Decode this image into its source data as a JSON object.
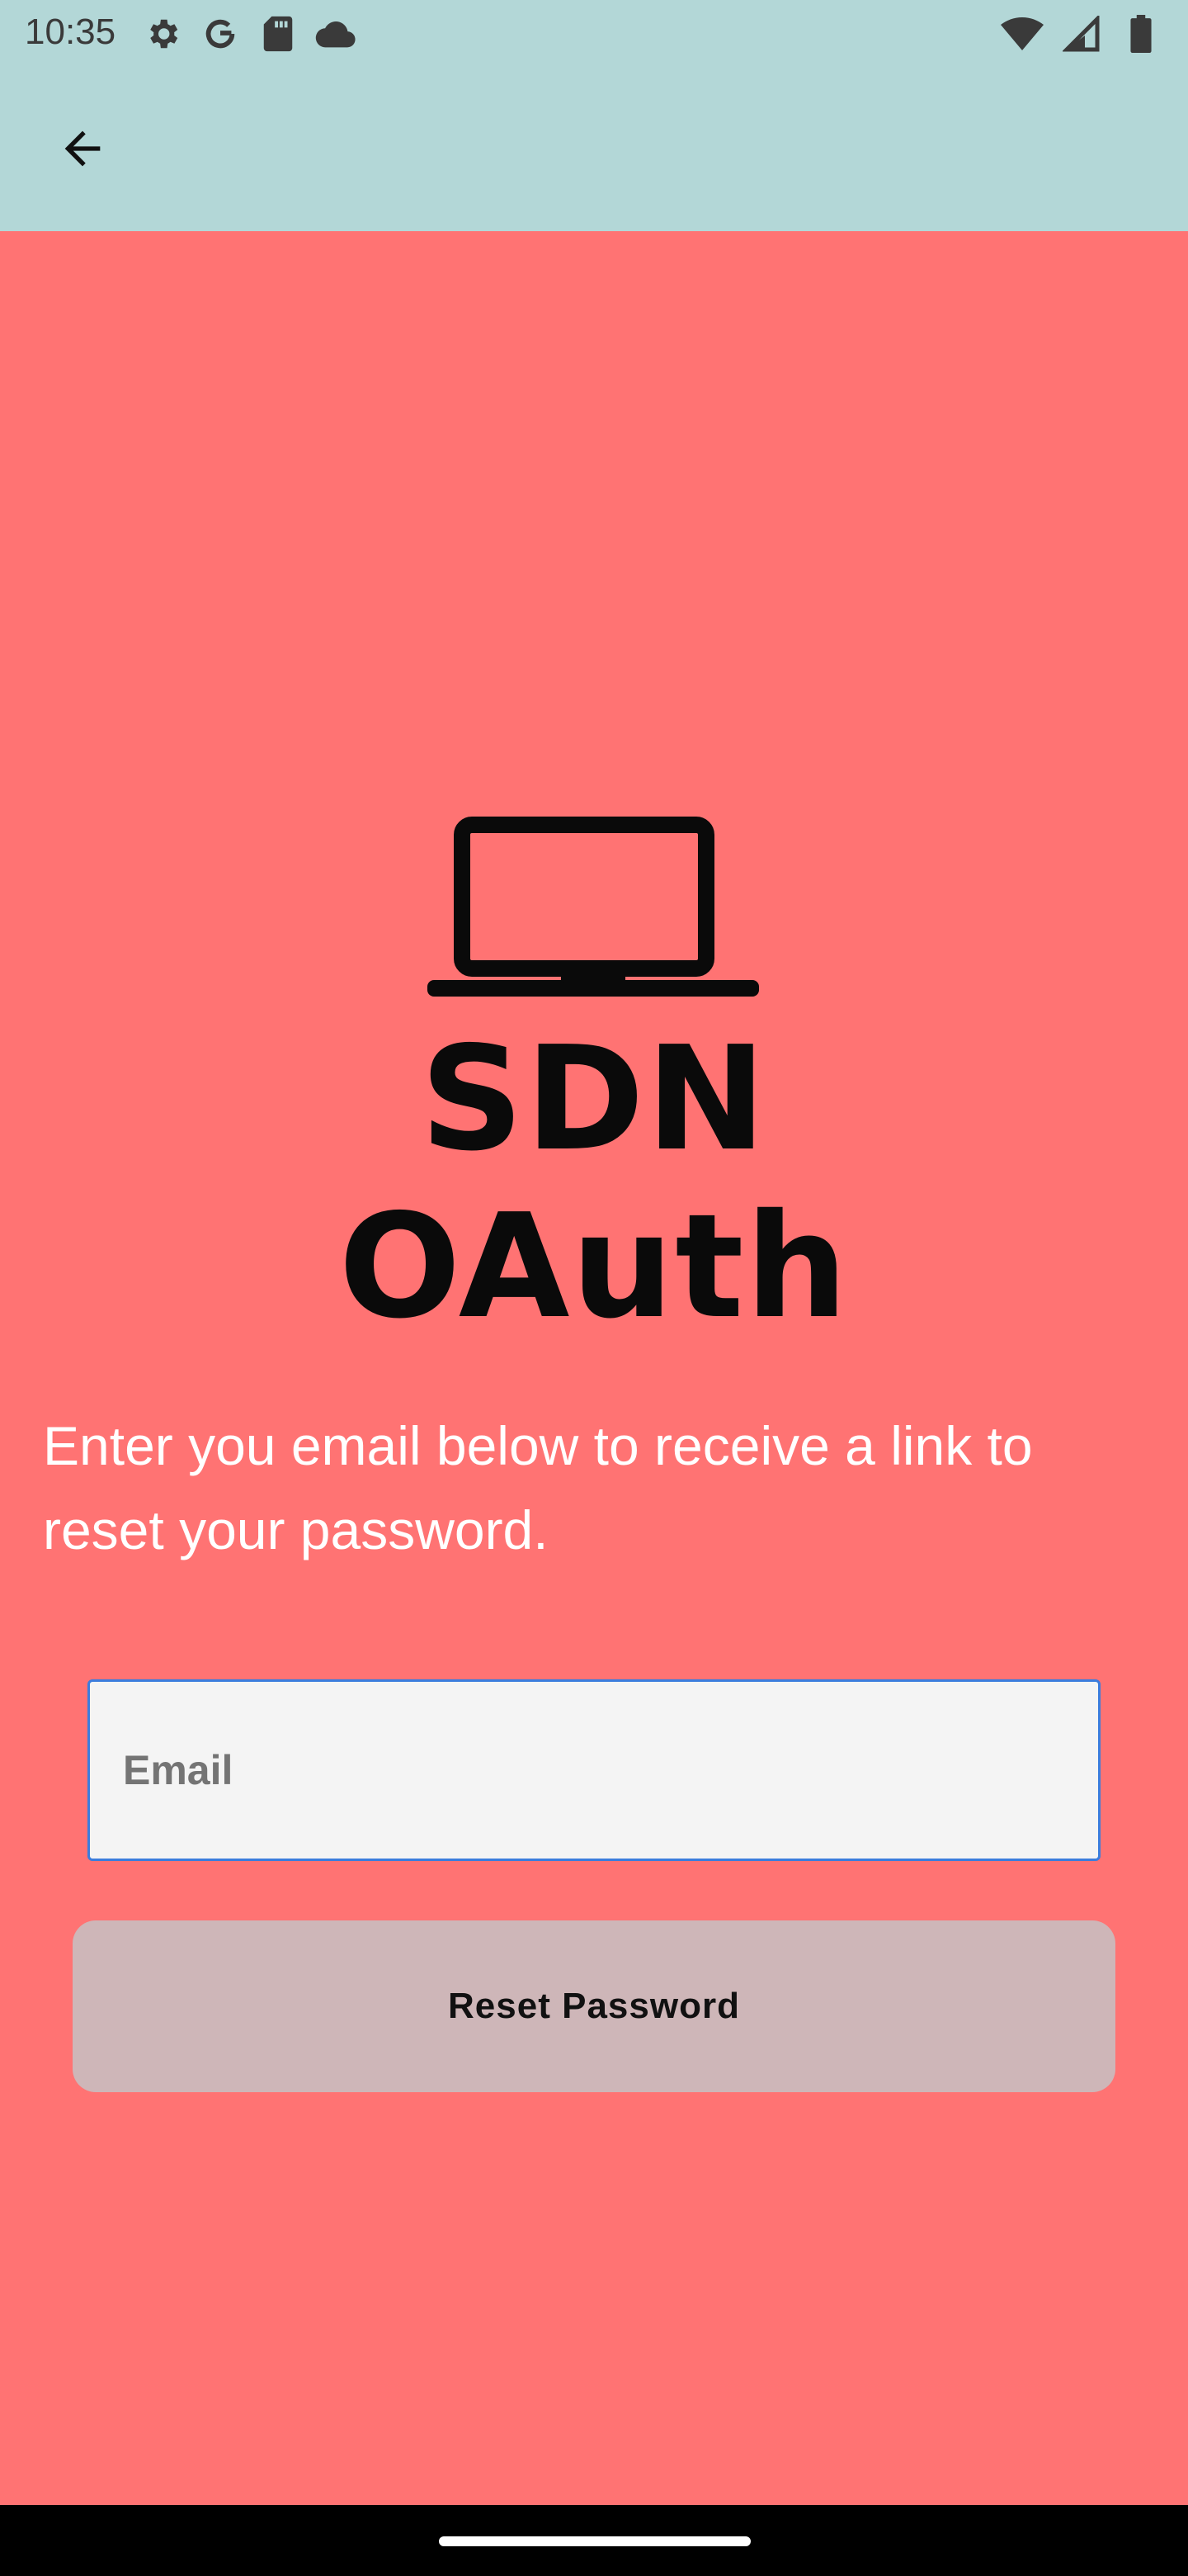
{
  "status_bar": {
    "time": "10:35",
    "left_icons": [
      "settings-icon",
      "google-icon",
      "sd-card-icon",
      "cloud-icon"
    ],
    "right_icons": [
      "wifi-icon",
      "signal-icon",
      "battery-icon"
    ]
  },
  "app_bar": {
    "back_icon": "arrow-back-icon",
    "background": "#b3d7d7"
  },
  "logo": {
    "text": "SDN OAuth",
    "icon": "laptop-icon"
  },
  "instruction_text": "Enter you email below to receive a link to reset your password.",
  "email_field": {
    "placeholder": "Email",
    "value": ""
  },
  "reset_button": {
    "label": "Reset Password"
  },
  "colors": {
    "page_background": "#ff7373",
    "button_background": "#ceb6b8",
    "field_border": "#3b7ddd"
  }
}
